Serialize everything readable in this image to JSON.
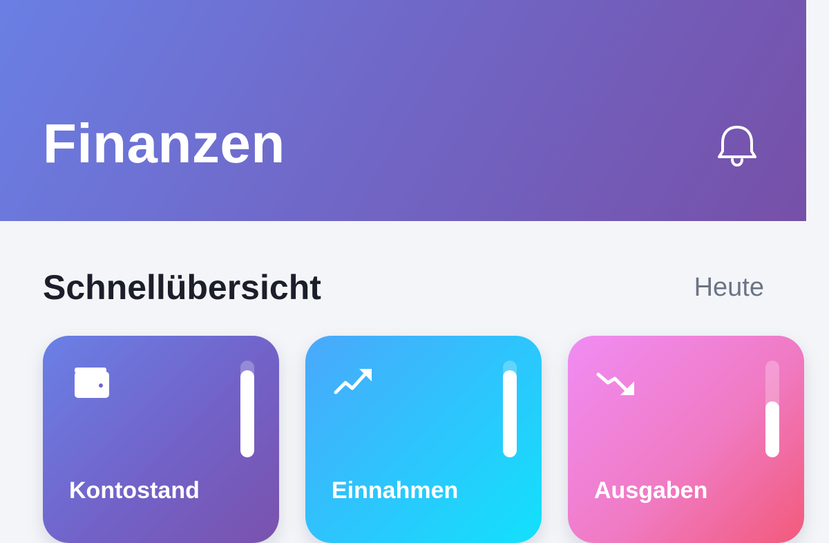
{
  "header": {
    "title": "Finanzen",
    "notification_icon": "bell-icon"
  },
  "overview": {
    "title": "Schnellübersicht",
    "period": "Heute"
  },
  "cards": [
    {
      "label": "Kontostand",
      "icon": "wallet-icon",
      "level": 0.9
    },
    {
      "label": "Einnahmen",
      "icon": "trending-up-icon",
      "level": 0.9
    },
    {
      "label": "Ausgaben",
      "icon": "trending-down-icon",
      "level": 0.58
    }
  ],
  "colors": {
    "header_gradient": [
      "#6a7fe4",
      "#7650a8"
    ],
    "kontostand_gradient": [
      "#6a80e6",
      "#7a52ac"
    ],
    "einnahmen_gradient": [
      "#4aa8fb",
      "#12e1fb"
    ],
    "ausgaben_gradient": [
      "#f08cf4",
      "#f25a7a"
    ],
    "background": "#f4f5f8",
    "text_dark": "#1b1f2a",
    "text_muted": "#6b7486"
  }
}
